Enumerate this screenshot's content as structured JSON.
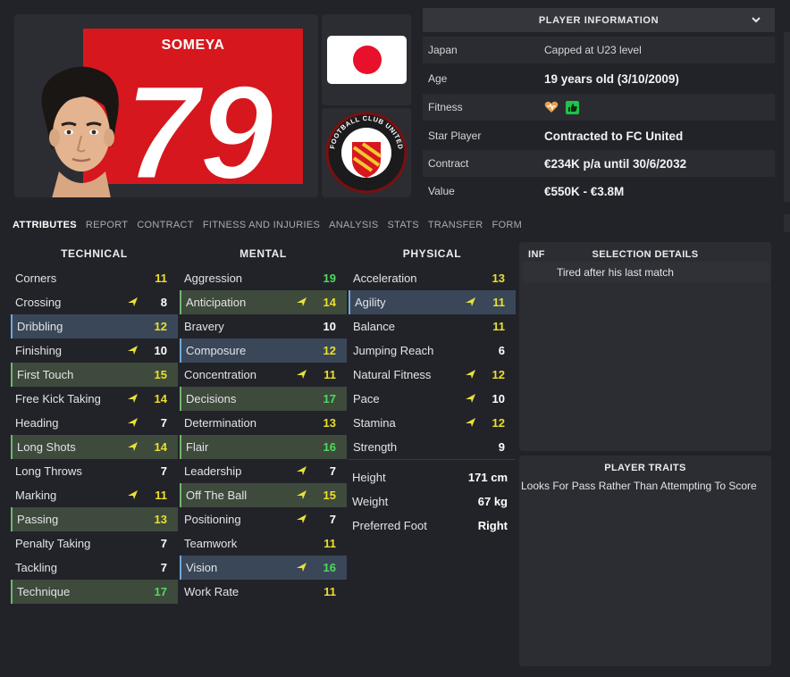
{
  "player": {
    "name": "SOMEYA",
    "number": "79"
  },
  "info": {
    "title": "PLAYER INFORMATION",
    "rows": [
      {
        "key": "Japan",
        "value": "Capped at U23 level"
      },
      {
        "key": "Age",
        "value": "19 years old (3/10/2009)"
      },
      {
        "key": "Fitness",
        "value": ""
      },
      {
        "key": "Star Player",
        "value": "Contracted to FC United"
      },
      {
        "key": "Contract",
        "value": "€234K p/a until 30/6/2032"
      },
      {
        "key": "Value",
        "value": "€550K - €3.8M"
      }
    ]
  },
  "tabs": [
    "ATTRIBUTES",
    "REPORT",
    "CONTRACT",
    "FITNESS AND INJURIES",
    "ANALYSIS",
    "STATS",
    "TRANSFER",
    "FORM"
  ],
  "columns": {
    "technical": "TECHNICAL",
    "mental": "MENTAL",
    "physical": "PHYSICAL"
  },
  "technical": [
    {
      "name": "Corners",
      "value": "11",
      "color": "yellow",
      "up": false,
      "hl": ""
    },
    {
      "name": "Crossing",
      "value": "8",
      "color": "white",
      "up": true,
      "hl": ""
    },
    {
      "name": "Dribbling",
      "value": "12",
      "color": "yellow",
      "up": false,
      "hl": "b"
    },
    {
      "name": "Finishing",
      "value": "10",
      "color": "white",
      "up": true,
      "hl": ""
    },
    {
      "name": "First Touch",
      "value": "15",
      "color": "yellow",
      "up": false,
      "hl": "g"
    },
    {
      "name": "Free Kick Taking",
      "value": "14",
      "color": "yellow",
      "up": true,
      "hl": ""
    },
    {
      "name": "Heading",
      "value": "7",
      "color": "white",
      "up": true,
      "hl": ""
    },
    {
      "name": "Long Shots",
      "value": "14",
      "color": "yellow",
      "up": true,
      "hl": "g"
    },
    {
      "name": "Long Throws",
      "value": "7",
      "color": "white",
      "up": false,
      "hl": ""
    },
    {
      "name": "Marking",
      "value": "11",
      "color": "yellow",
      "up": true,
      "hl": ""
    },
    {
      "name": "Passing",
      "value": "13",
      "color": "yellow",
      "up": false,
      "hl": "g"
    },
    {
      "name": "Penalty Taking",
      "value": "7",
      "color": "white",
      "up": false,
      "hl": ""
    },
    {
      "name": "Tackling",
      "value": "7",
      "color": "white",
      "up": false,
      "hl": ""
    },
    {
      "name": "Technique",
      "value": "17",
      "color": "green",
      "up": false,
      "hl": "g"
    }
  ],
  "mental": [
    {
      "name": "Aggression",
      "value": "19",
      "color": "green",
      "up": false,
      "hl": ""
    },
    {
      "name": "Anticipation",
      "value": "14",
      "color": "yellow",
      "up": true,
      "hl": "g"
    },
    {
      "name": "Bravery",
      "value": "10",
      "color": "white",
      "up": false,
      "hl": ""
    },
    {
      "name": "Composure",
      "value": "12",
      "color": "yellow",
      "up": false,
      "hl": "b"
    },
    {
      "name": "Concentration",
      "value": "11",
      "color": "yellow",
      "up": true,
      "hl": ""
    },
    {
      "name": "Decisions",
      "value": "17",
      "color": "green",
      "up": false,
      "hl": "g"
    },
    {
      "name": "Determination",
      "value": "13",
      "color": "yellow",
      "up": false,
      "hl": ""
    },
    {
      "name": "Flair",
      "value": "16",
      "color": "green",
      "up": false,
      "hl": "g"
    },
    {
      "name": "Leadership",
      "value": "7",
      "color": "white",
      "up": true,
      "hl": ""
    },
    {
      "name": "Off The Ball",
      "value": "15",
      "color": "yellow",
      "up": true,
      "hl": "g"
    },
    {
      "name": "Positioning",
      "value": "7",
      "color": "white",
      "up": true,
      "hl": ""
    },
    {
      "name": "Teamwork",
      "value": "11",
      "color": "yellow",
      "up": false,
      "hl": ""
    },
    {
      "name": "Vision",
      "value": "16",
      "color": "green",
      "up": true,
      "hl": "b"
    },
    {
      "name": "Work Rate",
      "value": "11",
      "color": "yellow",
      "up": false,
      "hl": ""
    }
  ],
  "physical": [
    {
      "name": "Acceleration",
      "value": "13",
      "color": "yellow",
      "up": false,
      "hl": ""
    },
    {
      "name": "Agility",
      "value": "11",
      "color": "yellow",
      "up": true,
      "hl": "b"
    },
    {
      "name": "Balance",
      "value": "11",
      "color": "yellow",
      "up": false,
      "hl": ""
    },
    {
      "name": "Jumping Reach",
      "value": "6",
      "color": "white",
      "up": false,
      "hl": ""
    },
    {
      "name": "Natural Fitness",
      "value": "12",
      "color": "yellow",
      "up": true,
      "hl": ""
    },
    {
      "name": "Pace",
      "value": "10",
      "color": "white",
      "up": true,
      "hl": ""
    },
    {
      "name": "Stamina",
      "value": "12",
      "color": "yellow",
      "up": true,
      "hl": ""
    },
    {
      "name": "Strength",
      "value": "9",
      "color": "white",
      "up": false,
      "hl": ""
    }
  ],
  "misc": [
    {
      "name": "Height",
      "value": "171 cm"
    },
    {
      "name": "Weight",
      "value": "67 kg"
    },
    {
      "name": "Preferred Foot",
      "value": "Right"
    }
  ],
  "selection": {
    "inf": "INF",
    "title": "SELECTION DETAILS",
    "text": "Tired after his last match"
  },
  "traits": {
    "title": "PLAYER TRAITS",
    "text": "Looks For Pass Rather Than Attempting To Score"
  },
  "colors": {
    "kit_red": "#d6171e",
    "attr_white": "#ffffff",
    "attr_yellow": "#ecdf2a",
    "attr_green": "#4fdb5c",
    "arrow": "#e8e23c"
  },
  "icons": {
    "fitness": "heart-icon",
    "fitness_status": "thumbs-up-icon",
    "expand": "chevron-down-icon",
    "trend": "arrow-up-icon"
  }
}
